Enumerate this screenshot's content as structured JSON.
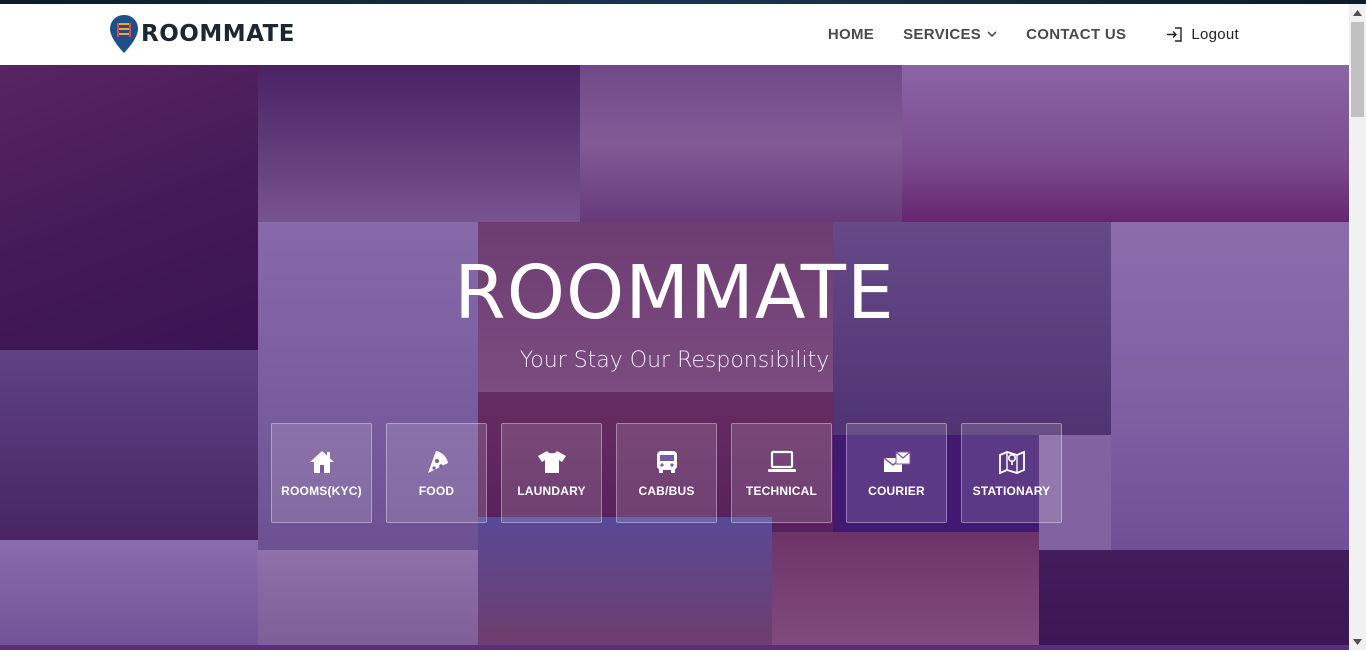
{
  "brand": {
    "name_part1": "ROOM",
    "name_part2": "MATE"
  },
  "nav": {
    "home": "HOME",
    "services": "SERVICES",
    "contact": "CONTACT US",
    "logout": "Logout"
  },
  "hero": {
    "title": "ROOMMATE",
    "subtitle": "Your Stay Our Responsibility"
  },
  "services": [
    {
      "label": "ROOMS(KYC)",
      "icon": "home-icon"
    },
    {
      "label": "FOOD",
      "icon": "pizza-icon"
    },
    {
      "label": "LAUNDARY",
      "icon": "tshirt-icon"
    },
    {
      "label": "CAB/BUS",
      "icon": "bus-icon"
    },
    {
      "label": "TECHNICAL",
      "icon": "laptop-icon"
    },
    {
      "label": "COURIER",
      "icon": "courier-icon"
    },
    {
      "label": "STATIONARY",
      "icon": "map-icon"
    }
  ],
  "colors": {
    "overlay": "#48148c",
    "brand_dark": "#1d2733",
    "brand_pin": "#1f4f8a",
    "nav_text": "#4a4a4a"
  }
}
